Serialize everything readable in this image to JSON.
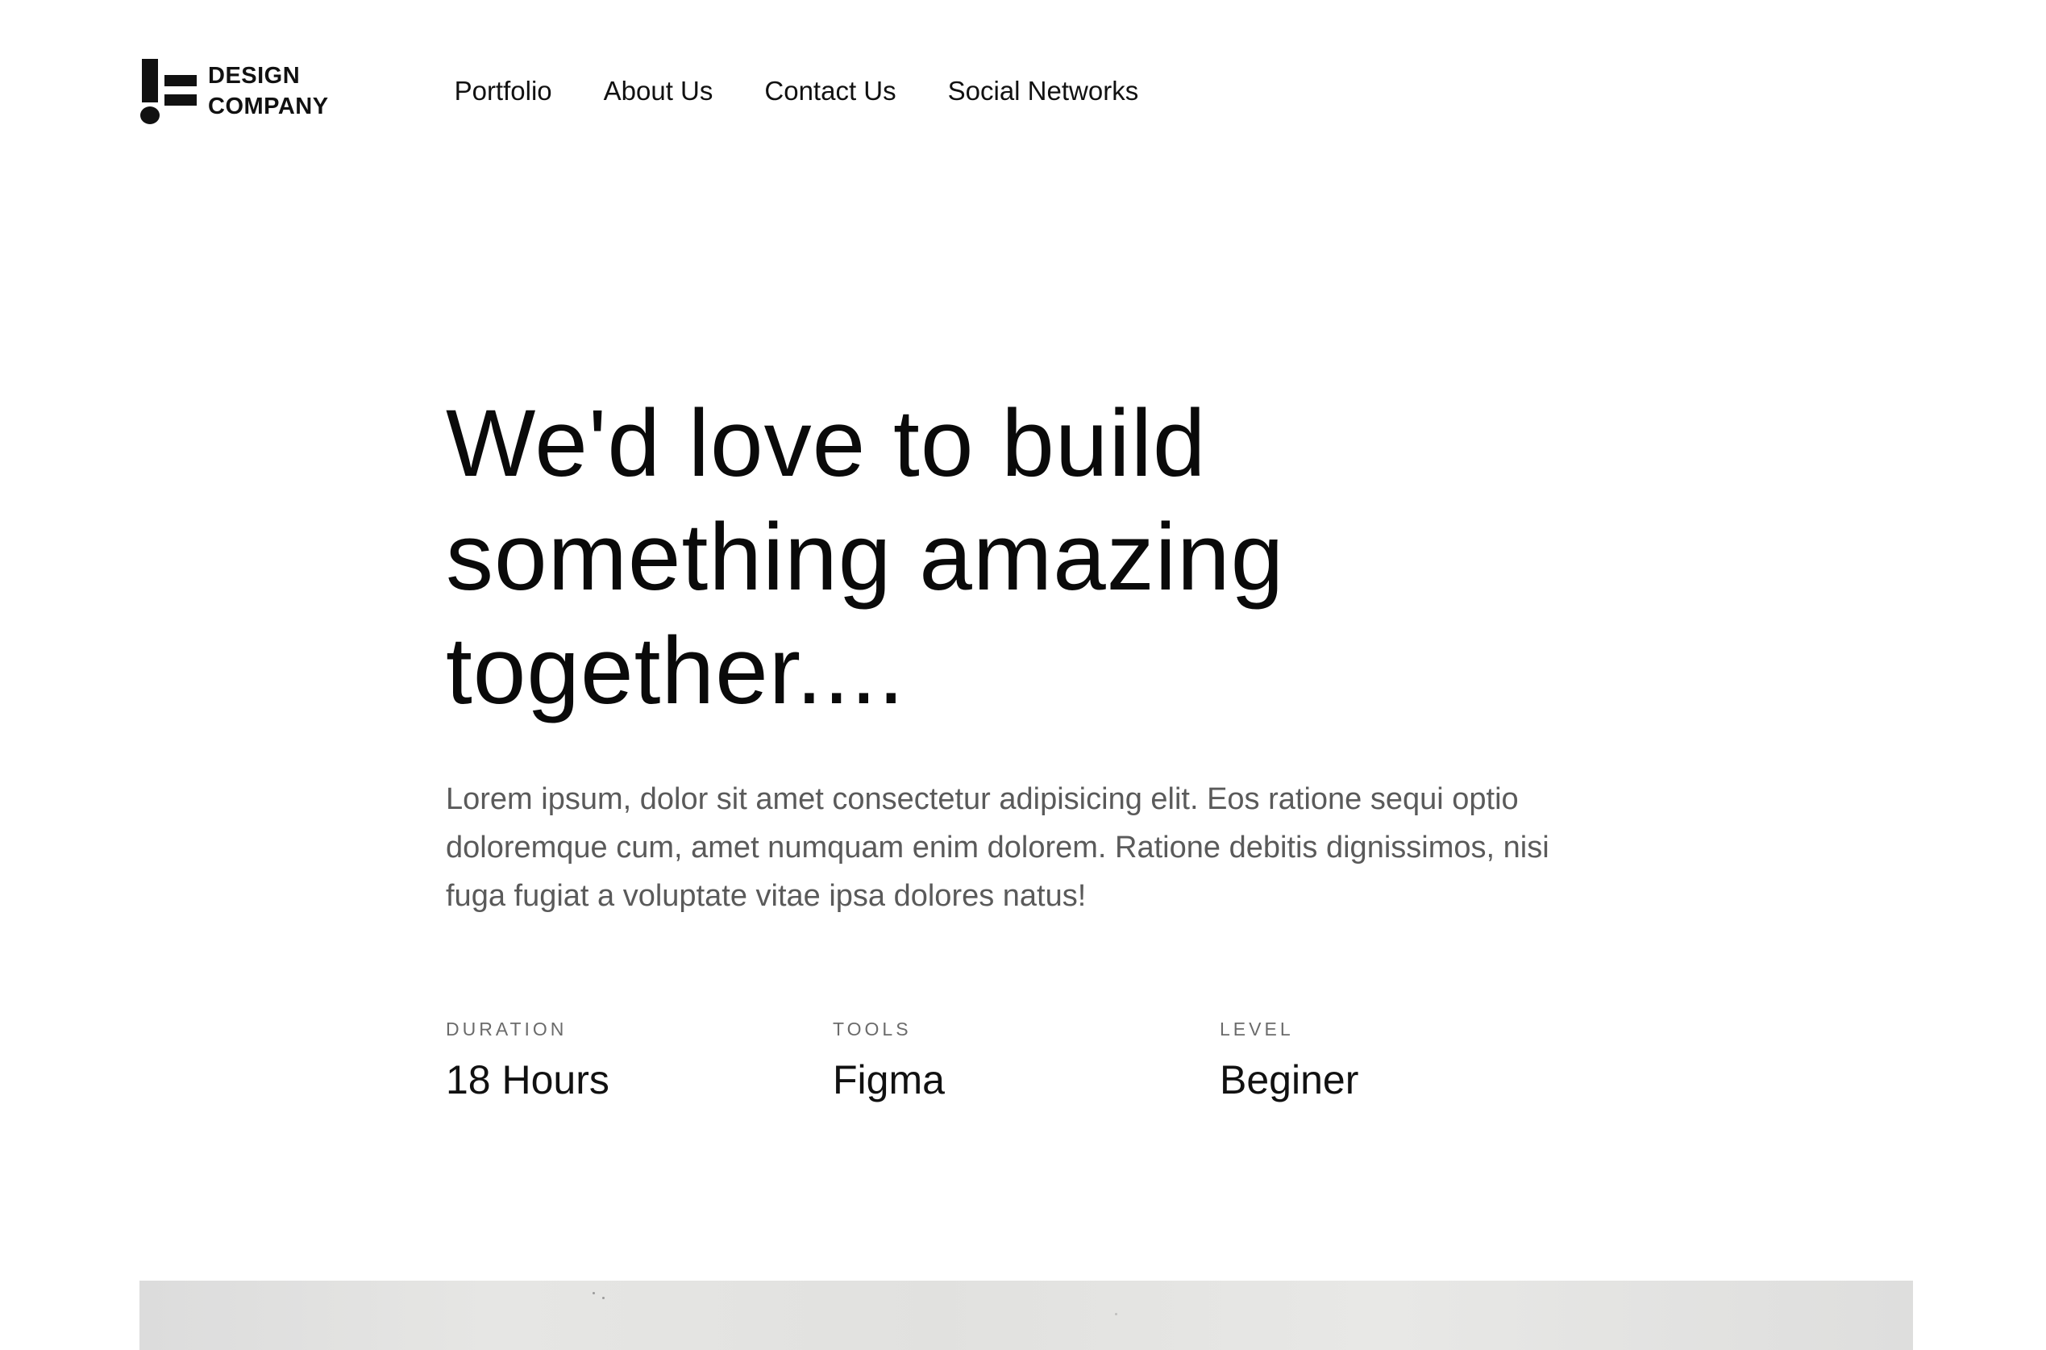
{
  "brand": {
    "line1": "DESIGN",
    "line2": "COMPANY",
    "logo_icon": "exclamation-bars-logo-icon"
  },
  "nav": {
    "items": [
      {
        "label": "Portfolio"
      },
      {
        "label": "About Us"
      },
      {
        "label": "Contact Us"
      },
      {
        "label": "Social Networks"
      }
    ]
  },
  "hero": {
    "title": "We'd love to build something amazing together....",
    "description": "Lorem ipsum, dolor sit amet consectetur adipisicing elit. Eos ratione sequi optio doloremque cum, amet numquam enim dolorem. Ratione debitis dignissimos, nisi fuga fugiat a voluptate vitae ipsa dolores natus!"
  },
  "stats": [
    {
      "label": "DURATION",
      "value": "18 Hours"
    },
    {
      "label": "TOOLS",
      "value": "Figma"
    },
    {
      "label": "LEVEL",
      "value": "Beginer"
    }
  ],
  "colors": {
    "background": "#ffffff",
    "text": "#111111",
    "muted_text": "#5a5a5a",
    "label_text": "#6b6b6b",
    "banner": "#e3e3e1"
  }
}
